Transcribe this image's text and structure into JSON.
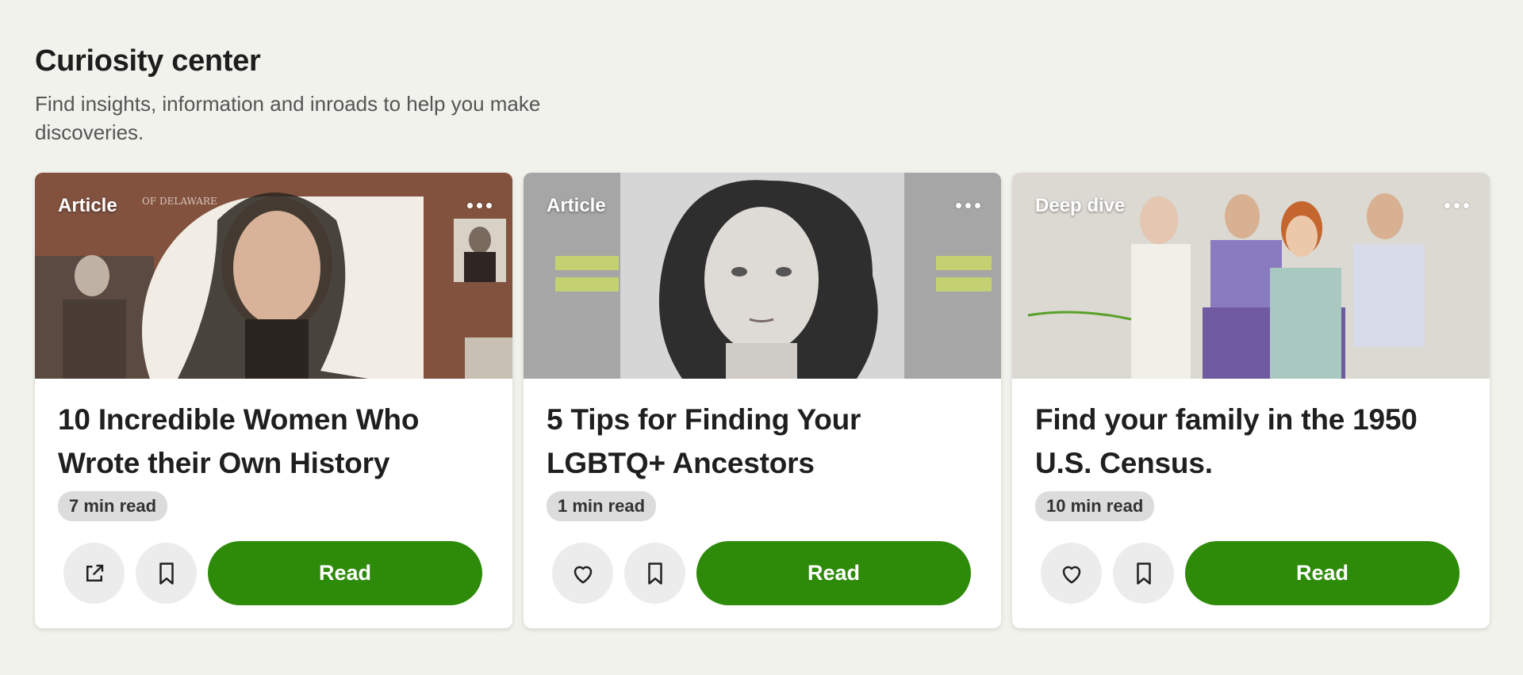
{
  "section": {
    "title": "Curiosity center",
    "subtitle": "Find insights, information and inroads to help you make discoveries."
  },
  "cards": [
    {
      "type": "Article",
      "title": "10 Incredible Women Who Wrote their Own History",
      "read_time": "7 min read",
      "first_action_icon": "external-link-icon",
      "second_action_icon": "bookmark-icon",
      "read_label": "Read",
      "image": "portrait-of-woman-with-archival-documents"
    },
    {
      "type": "Article",
      "title": "5 Tips for Finding Your LGBTQ+ Ancestors",
      "read_time": "1 min read",
      "first_action_icon": "heart-icon",
      "second_action_icon": "bookmark-icon",
      "read_label": "Read",
      "image": "black-and-white-portrait-with-census-records"
    },
    {
      "type": "Deep dive",
      "title": "Find your family in the 1950 U.S. Census.",
      "read_time": "10 min read",
      "first_action_icon": "heart-icon",
      "second_action_icon": "bookmark-icon",
      "read_label": "Read",
      "image": "colorized-teens-playing-cards"
    }
  ],
  "colors": {
    "page_background": "#f2f2ec",
    "read_button": "#2e8b0a",
    "read_time_badge": "#dcdcdc",
    "icon_button": "#ececec"
  }
}
